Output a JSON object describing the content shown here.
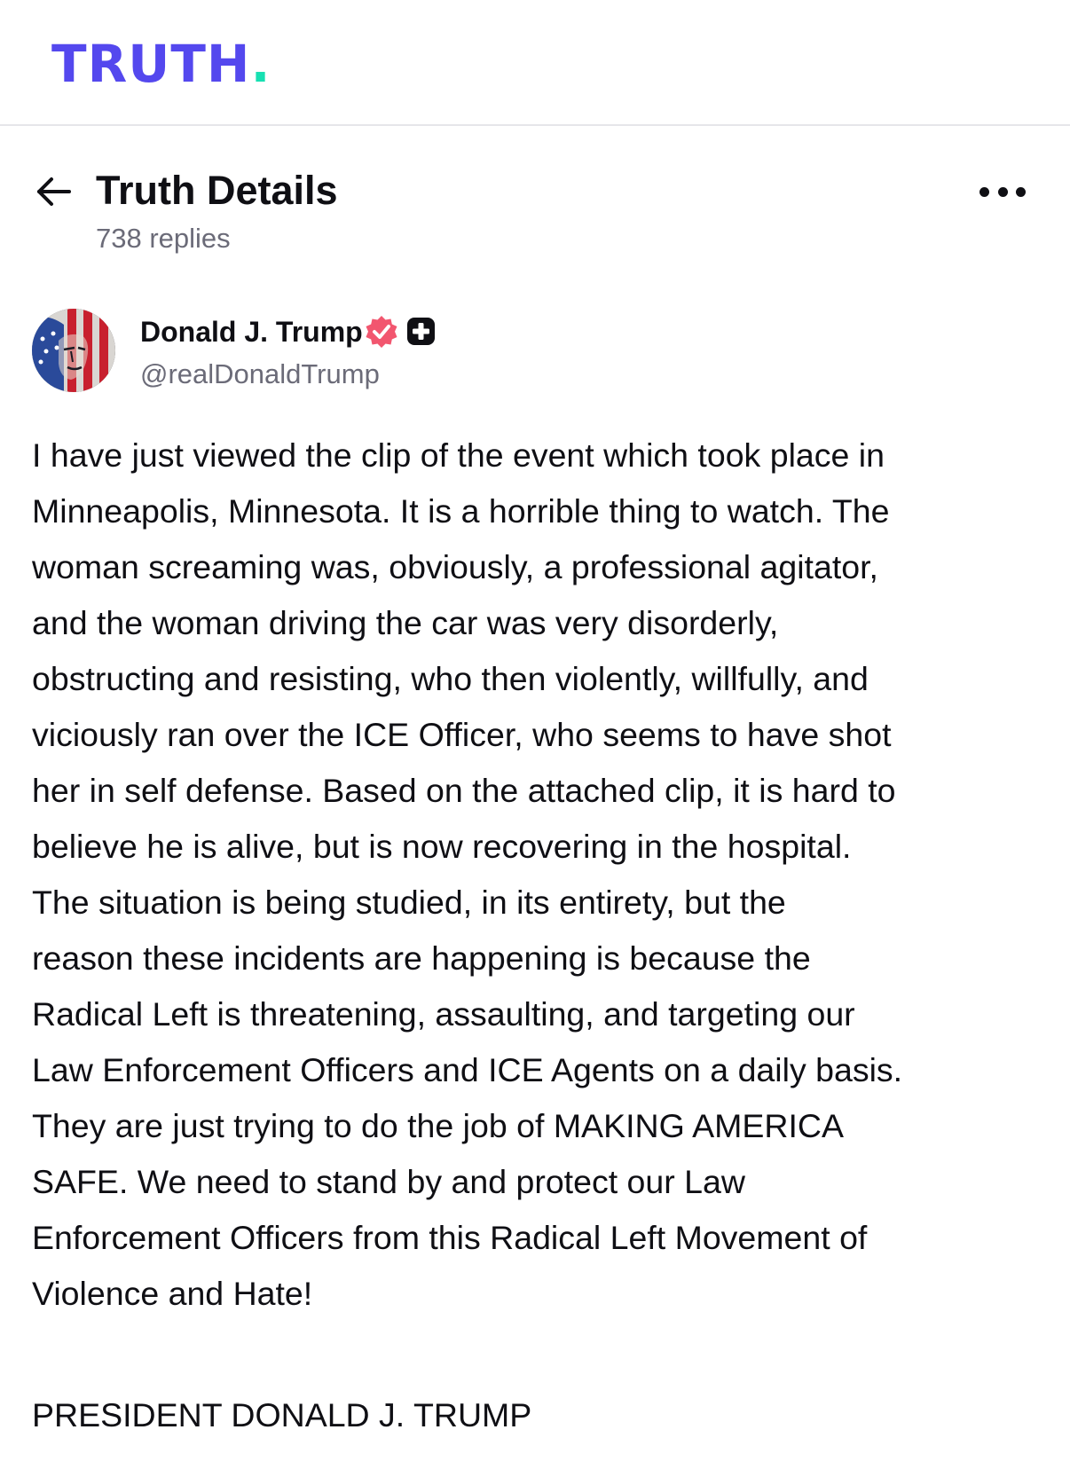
{
  "app": {
    "logo_text": "TRUTH",
    "logo_dot": ".",
    "brand_color": "#5448ee",
    "brand_accent": "#17e0b2"
  },
  "header": {
    "back_icon": "arrow-left-icon",
    "title": "Truth Details",
    "replies": "738 replies",
    "more_icon": "more-horizontal-icon"
  },
  "post": {
    "author": {
      "name": "Donald J. Trump",
      "handle": "@realDonaldTrump",
      "avatar_icon": "flag-portrait-avatar",
      "badges": [
        "verified-badge-icon",
        "plus-badge-icon"
      ],
      "verified_color": "#f2566f"
    },
    "body": "I have just viewed the clip of the event which took place in\nMinneapolis, Minnesota. It is a horrible thing to watch. The\nwoman screaming was, obviously, a professional agitator,\nand the woman driving the car was very disorderly,\nobstructing and resisting, who then violently, willfully, and\nviciously ran over the ICE Officer, who seems to have shot\nher in self defense. Based on the attached clip, it is hard to\nbelieve he is alive, but is now recovering in the hospital.\nThe situation is being studied, in its entirety, but the\nreason these incidents are happening is because the\nRadical Left is threatening, assaulting, and targeting our\nLaw Enforcement Officers and ICE Agents on a daily basis.\nThey are just trying to do the job of MAKING AMERICA\nSAFE. We need to stand by and protect our Law\nEnforcement Officers from this Radical Left Movement of\nViolence and Hate!",
    "signature": "PRESIDENT DONALD J. TRUMP"
  }
}
